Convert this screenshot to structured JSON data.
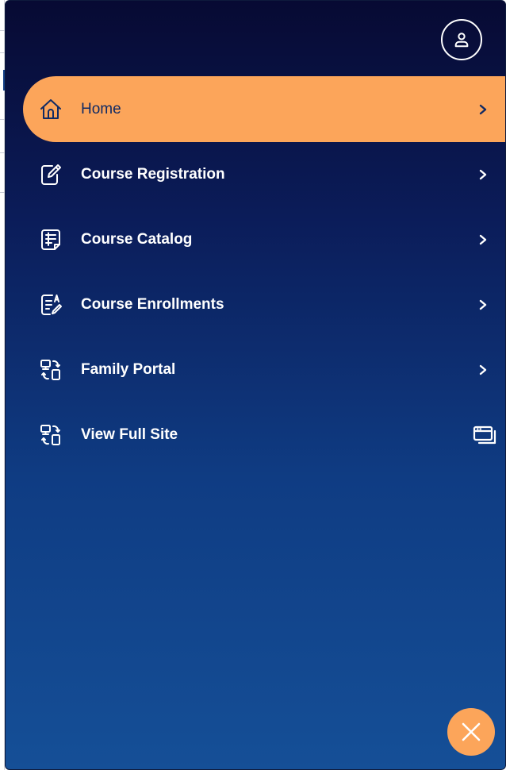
{
  "menu": {
    "items": [
      {
        "label": "Home",
        "icon": "home-icon",
        "trail_icon": "chevron-right-icon",
        "active": true
      },
      {
        "label": "Course Registration",
        "icon": "edit-form-icon",
        "trail_icon": "chevron-right-icon",
        "active": false
      },
      {
        "label": "Course Catalog",
        "icon": "catalog-list-icon",
        "trail_icon": "chevron-right-icon",
        "active": false
      },
      {
        "label": "Course Enrollments",
        "icon": "enrollment-doc-icon",
        "trail_icon": "chevron-right-icon",
        "active": false
      },
      {
        "label": "Family Portal",
        "icon": "device-switch-icon",
        "trail_icon": "chevron-right-icon",
        "active": false
      },
      {
        "label": "View Full Site",
        "icon": "device-switch-icon",
        "trail_icon": "browser-window-icon",
        "active": false
      }
    ]
  },
  "header": {
    "profile_icon": "user-profile-icon"
  },
  "footer": {
    "close_icon": "close-x-icon"
  },
  "colors": {
    "drawer_top": "#070a33",
    "drawer_bottom": "#154f97",
    "accent_orange": "#fca55a",
    "active_text": "#102a64",
    "text": "#ffffff"
  }
}
